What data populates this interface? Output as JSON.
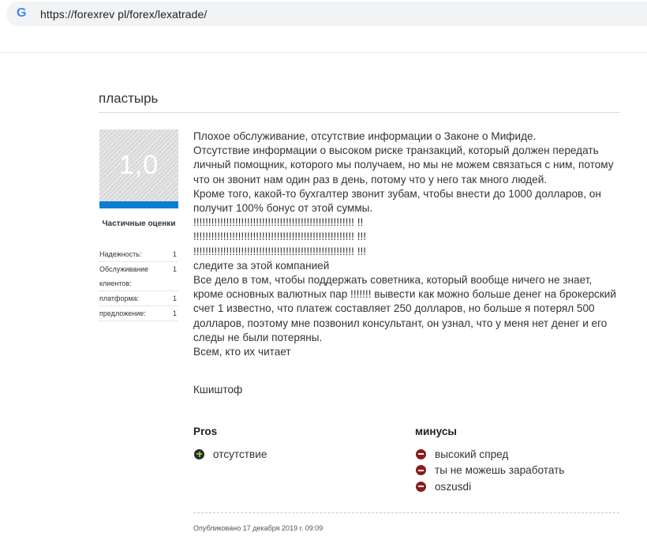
{
  "browser": {
    "url": "https://forexrev pl/forex/lexatrade/",
    "icon": "google-g-icon"
  },
  "review": {
    "title": "пластырь",
    "rating": "1,0",
    "rating_fraction": 0.2,
    "rating_bar_color": "#0a7fd1",
    "partial_scores_title": "Частичные оценки",
    "partial_scores": [
      {
        "label": "Надежность:",
        "value": "1"
      },
      {
        "label": "Обслуживание клиентов:",
        "value": "1"
      },
      {
        "label": "платформа:",
        "value": "1"
      },
      {
        "label": "предложение:",
        "value": "1"
      }
    ],
    "body_lines": [
      "Плохое обслуживание, отсутствие информации о Законе о Мифиде.",
      "Отсутствие информации о высоком риске транзакций, который должен передать личный помощник, которого мы получаем, но мы не можем связаться с ним, потому что он звонит нам один раз в день, потому что у него так много людей.",
      "Кроме того, какой-то бухгалтер звонит зубам, чтобы внести до 1000 долларов, он получит 100% бонус от этой суммы.",
      "!!!!!!!!!!!!!!!!!!!!!!!!!!!!!!!!!!!!!!!!!!!!!!!!!!!!!! !!",
      "!!!!!!!!!!!!!!!!!!!!!!!!!!!!!!!!!!!!!!!!!!!!!!!!!!!!!! !!!",
      "!!!!!!!!!!!!!!!!!!!!!!!!!!!!!!!!!!!!!!!!!!!!!!!!!!!!!! !!!",
      "следите за этой компанией",
      "Все дело в том, чтобы поддержать советника, который вообще ничего не знает, кроме основных валютных пар !!!!!!! вывести как можно больше денег на брокерский счет 1 известно, что платеж составляет 250 долларов, но больше я потерял 500 долларов, поэтому мне позвонил консультант, он узнал, что у меня нет денег и его следы не были потеряны.",
      "Всем, кто их читает"
    ],
    "author": "Кшиштоф",
    "pros_title": "Pros",
    "pros": [
      "отсутствие"
    ],
    "cons_title": "минусы",
    "cons": [
      "высокий спред",
      "ты не можешь заработать",
      "oszusdi"
    ],
    "published": "Опубликовано 17 декабря 2019 г. 09:09"
  }
}
